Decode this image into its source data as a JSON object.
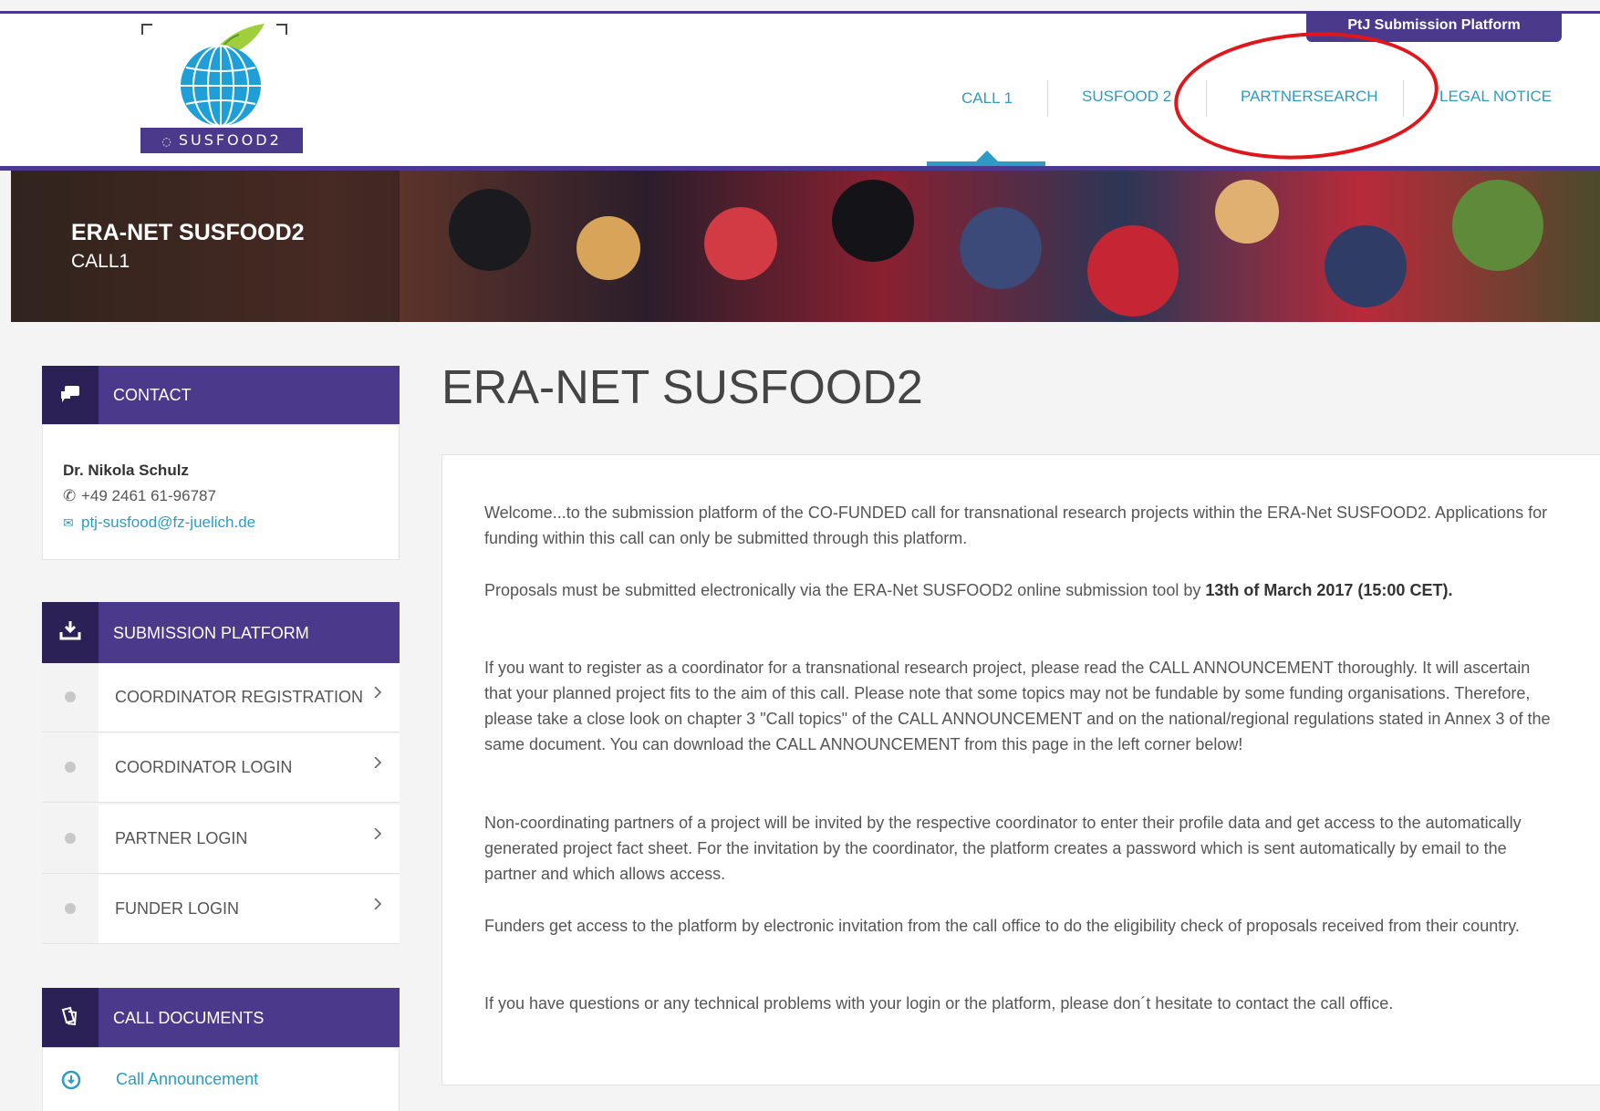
{
  "header": {
    "platform_tab": "PtJ Submission Platform",
    "logo_text": "SUSFOOD2",
    "nav": [
      {
        "label": "CALL 1"
      },
      {
        "label": "SUSFOOD 2"
      },
      {
        "label": "PARTNERSEARCH"
      },
      {
        "label": "LEGAL NOTICE"
      }
    ]
  },
  "banner": {
    "title": "ERA-NET SUSFOOD2",
    "subtitle": "CALL1"
  },
  "sidebar": {
    "contact": {
      "heading": "CONTACT",
      "name": "Dr. Nikola Schulz",
      "phone": "+49 2461 61-96787",
      "email": "ptj-susfood@fz-juelich.de"
    },
    "submission": {
      "heading": "SUBMISSION PLATFORM",
      "items": [
        {
          "label": "COORDINATOR REGISTRATION"
        },
        {
          "label": "COORDINATOR LOGIN"
        },
        {
          "label": "PARTNER LOGIN"
        },
        {
          "label": "FUNDER LOGIN"
        }
      ]
    },
    "documents": {
      "heading": "CALL DOCUMENTS",
      "items": [
        {
          "label": "Call Announcement"
        }
      ]
    }
  },
  "main": {
    "title": "ERA-NET SUSFOOD2",
    "paragraphs": {
      "p1": "Welcome...to the submission platform of the CO-FUNDED call for transnational research projects within the ERA-Net SUSFOOD2. Applications for funding within this call can only be submitted through this platform.",
      "p2_pre": "Proposals must be submitted electronically via the ERA-Net SUSFOOD2 online submission tool by ",
      "p2_bold": "13th of March 2017 (15:00 CET)",
      "p2_post": ".",
      "p3": "If you want to register as a coordinator for a transnational research project, please read the  CALL ANNOUNCEMENT thoroughly. It will ascertain that your planned project fits to the aim of this call. Please note that some topics may not be fundable by some funding organisations. Therefore, please take a close look on chapter 3 \"Call topics\" of the CALL ANNOUNCEMENT and on the national/regional regulations stated in Annex 3 of the same document. You can download the CALL ANNOUNCEMENT from this page in the left corner below!",
      "p4": "Non-coordinating partners of a project will be invited by the respective coordinator to enter their profile data and get access to the automatically generated project fact sheet. For the invitation by the coordinator, the platform creates a password which is sent automatically by email to the partner and which allows access.",
      "p5": "Funders get access to the platform by electronic invitation from the call office to do the eligibility check of proposals received from their country.",
      "p6": "If you have questions or any technical problems with your login or the platform, please don´t hesitate to contact the call office."
    }
  },
  "colors": {
    "brand_purple": "#4b3a8c",
    "link_blue": "#2e9bc3",
    "highlight_red": "#e0161b"
  }
}
